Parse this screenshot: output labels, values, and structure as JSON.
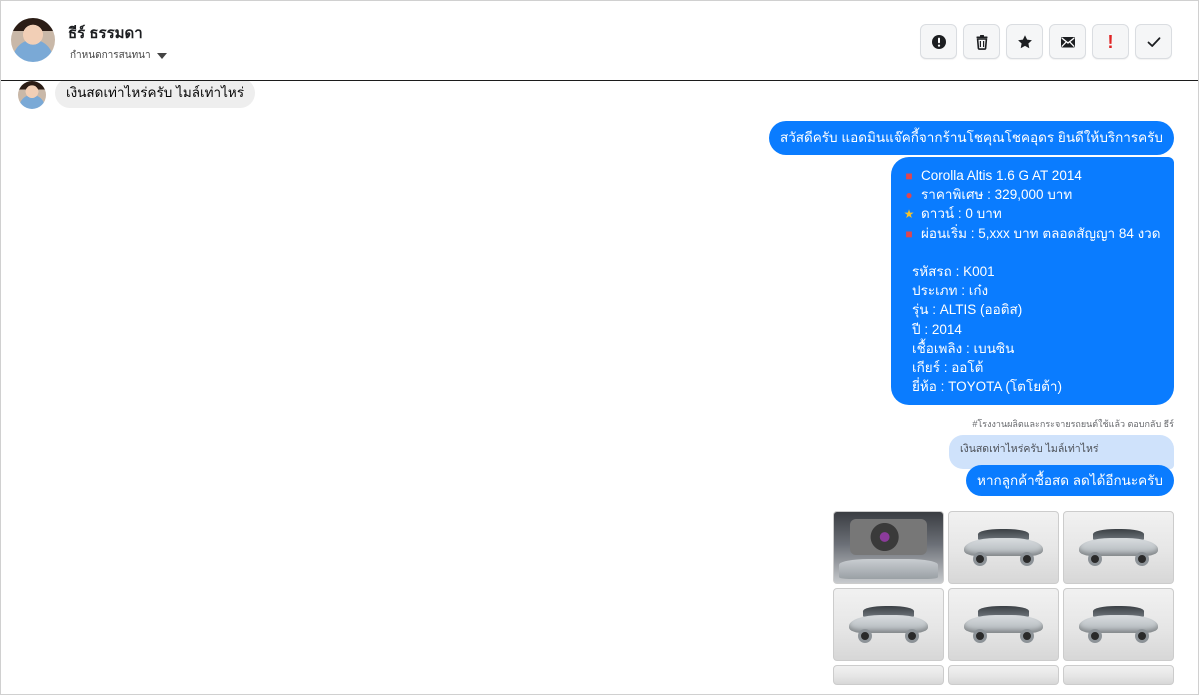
{
  "header": {
    "contact_name": "ธีร์ ธรรมดา",
    "status_label": "กำหนดการสนทนา",
    "actions": [
      {
        "name": "report-icon"
      },
      {
        "name": "trash-icon"
      },
      {
        "name": "star-icon"
      },
      {
        "name": "mail-icon"
      },
      {
        "name": "important-icon",
        "text": "!"
      },
      {
        "name": "check-icon"
      }
    ]
  },
  "chat": {
    "incoming_message": "เงินสดเท่าไหร่ครับ ไมล์เท่าไหร่",
    "outgoing_greeting": "สวัสดีครับ แอดมินแจ๊คกี้จากร้านโชคุณโชคอุดร ยินดีให้บริการครับ",
    "listing": {
      "lines": [
        {
          "emoji": "car-icon",
          "text": "Corolla Altis 1.6 G  AT 2014"
        },
        {
          "emoji": "pin-icon",
          "text": "ราคาพิเศษ : 329,000 บาท"
        },
        {
          "emoji": "star-icon",
          "text": "ดาวน์ : 0 บาท"
        },
        {
          "emoji": "car-icon",
          "text": "ผ่อนเริ่ม : 5,xxx บาท ตลอดสัญญา 84 งวด"
        }
      ],
      "details": [
        "รหัสรถ : K001",
        "ประเภท : เก๋ง",
        "รุ่น : ALTIS (ออติส)",
        "ปี : 2014",
        "เชื้อเพลิง : เบนซิน",
        "เกียร์ : ออโต้",
        "ยี่ห้อ : TOYOTA (โตโยต้า)"
      ]
    },
    "reply_meta": "#โรงงานผลิตและกระจายรถยนต์ใช้แล้ว ตอบกลับ ธีร์",
    "quoted_message": "เงินสดเท่าไหร่ครับ ไมล์เท่าไหร่",
    "reply_message": "หากลูกค้าซื้อสด ลดได้อีกนะครับ",
    "gallery": [
      {
        "name": "car-photo-engine"
      },
      {
        "name": "car-photo-front-left"
      },
      {
        "name": "car-photo-rear-right"
      },
      {
        "name": "car-photo-front-left-2"
      },
      {
        "name": "car-photo-front"
      },
      {
        "name": "car-photo-side"
      }
    ]
  },
  "colors": {
    "outgoing_bubble": "#0a7cff",
    "incoming_bubble": "#eeeeee",
    "quoted_bubble": "#cfe2fb",
    "important_icon": "#e02424"
  }
}
